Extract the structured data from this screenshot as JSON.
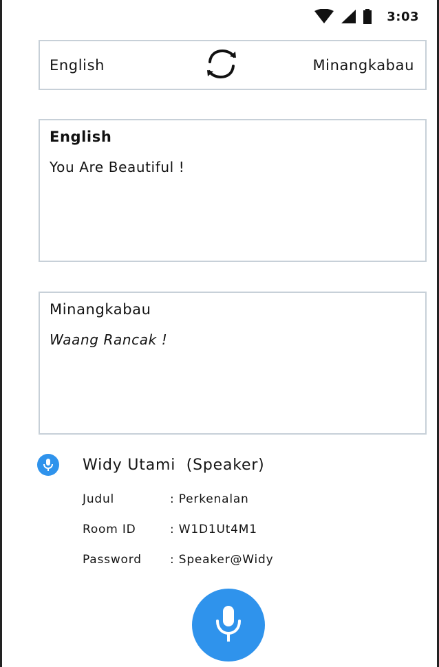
{
  "status_bar": {
    "time": "3:03",
    "icons": [
      "wifi-icon",
      "signal-icon",
      "battery-icon"
    ]
  },
  "language_bar": {
    "source_language": "English",
    "target_language": "Minangkabau",
    "swap_icon": "swap-arrows-icon"
  },
  "source_panel": {
    "title": "English",
    "text": "You Are Beautiful !"
  },
  "target_panel": {
    "title": "Minangkabau",
    "text": "Waang Rancak !"
  },
  "speaker": {
    "icon": "microphone-icon",
    "name": "Widy Utami  (Speaker)",
    "details": [
      {
        "key": "Judul",
        "value": ": Perkenalan"
      },
      {
        "key": "Room ID",
        "value": ": W1D1Ut4M1"
      },
      {
        "key": "Password",
        "value": ": Speaker@Widy"
      }
    ]
  },
  "mic_button": {
    "icon": "microphone-icon"
  },
  "colors": {
    "accent": "#2f93ec",
    "border": "#c7d0d8",
    "text": "#141414"
  }
}
